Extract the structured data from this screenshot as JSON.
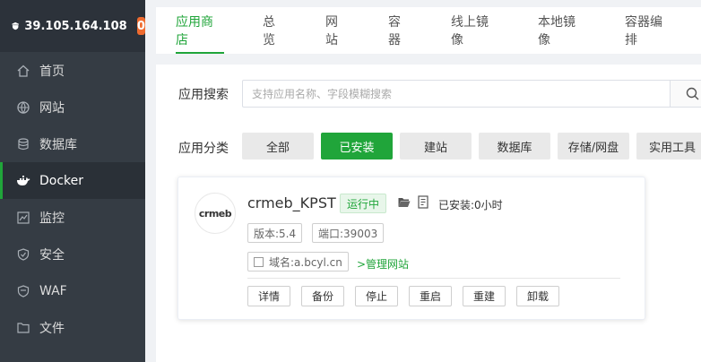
{
  "server": {
    "ip": "39.105.164.108",
    "badge": "0"
  },
  "sidebar": {
    "items": [
      {
        "label": "首页",
        "icon": "home-icon"
      },
      {
        "label": "网站",
        "icon": "globe-icon"
      },
      {
        "label": "数据库",
        "icon": "database-icon"
      },
      {
        "label": "Docker",
        "icon": "docker-icon",
        "active": true
      },
      {
        "label": "监控",
        "icon": "monitor-icon"
      },
      {
        "label": "安全",
        "icon": "shield-icon"
      },
      {
        "label": "WAF",
        "icon": "waf-icon"
      },
      {
        "label": "文件",
        "icon": "folder-icon"
      }
    ]
  },
  "tabs": [
    {
      "label": "应用商店",
      "active": true
    },
    {
      "label": "总览"
    },
    {
      "label": "网站"
    },
    {
      "label": "容器"
    },
    {
      "label": "线上镜像"
    },
    {
      "label": "本地镜像"
    },
    {
      "label": "容器编排"
    }
  ],
  "search": {
    "label": "应用搜索",
    "placeholder": "支持应用名称、字段模糊搜索"
  },
  "categories": {
    "label": "应用分类",
    "items": [
      "全部",
      "已安装",
      "建站",
      "数据库",
      "存储/网盘",
      "实用工具"
    ],
    "active_index": 1
  },
  "app": {
    "logo_text": "crmeb",
    "name": "crmeb_KPST",
    "status": "运行中",
    "installed": "已安装:0小时",
    "version": "版本:5.4",
    "port": "端口:39003",
    "domain": "域名:a.bcyl.cn",
    "manage_link": ">管理网站",
    "actions": [
      "详情",
      "备份",
      "停止",
      "重启",
      "重建",
      "卸载"
    ]
  },
  "colors": {
    "accent": "#20a53a",
    "sidebar": "#353c44",
    "badge": "#ef6b2f"
  }
}
